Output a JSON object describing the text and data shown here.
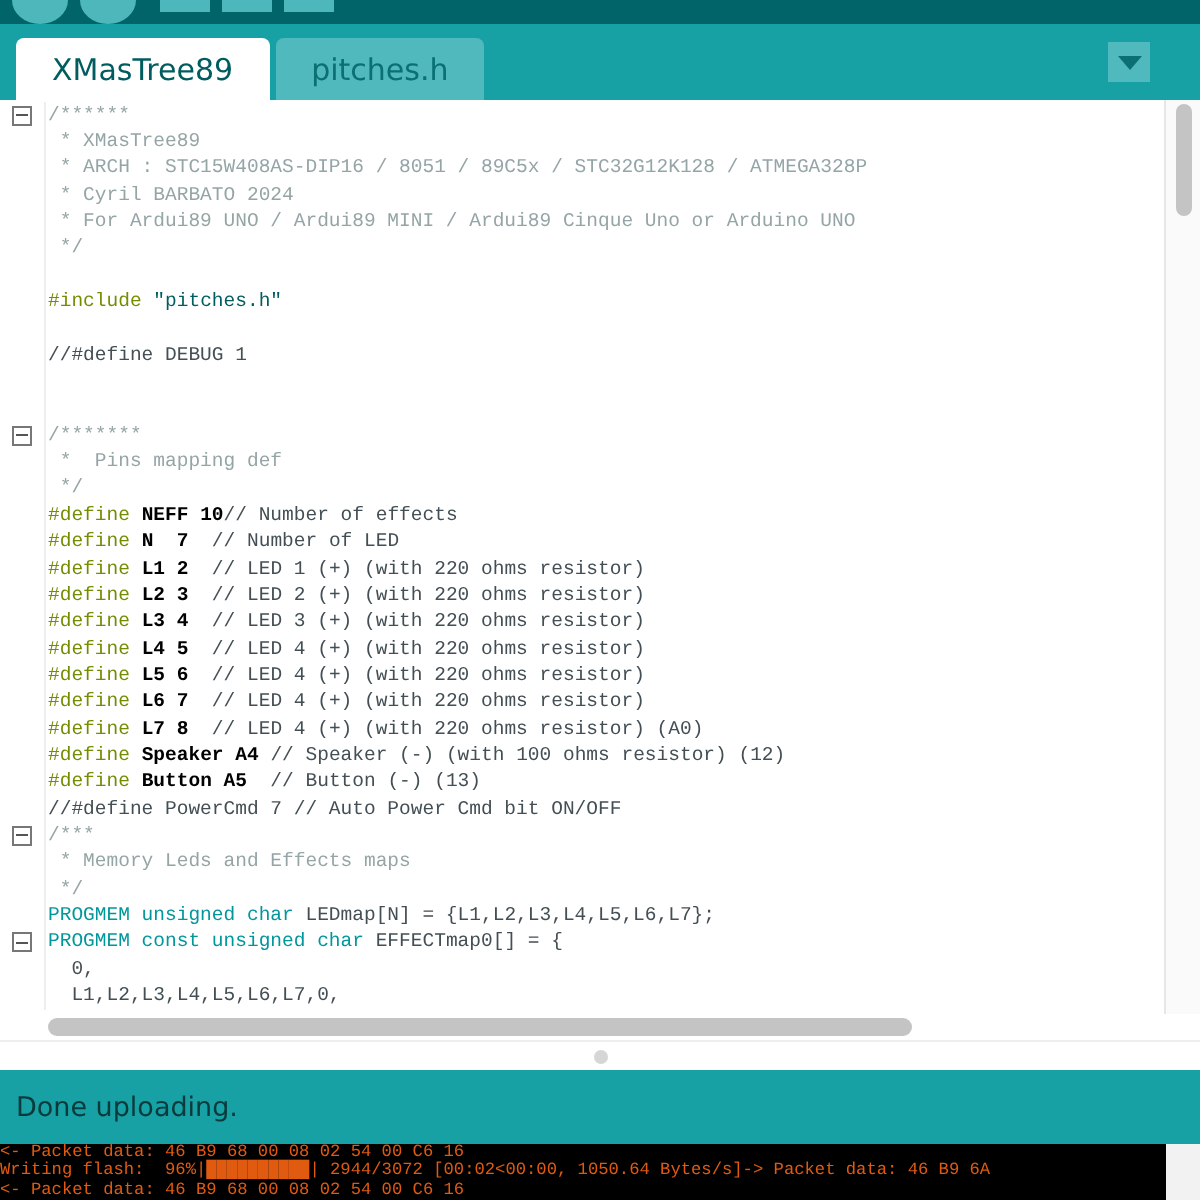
{
  "tabs": [
    {
      "label": "XMasTree89",
      "selected": true
    },
    {
      "label": "pitches.h",
      "selected": false
    }
  ],
  "editor": {
    "lines": [
      {
        "fold": true,
        "tokens": [
          {
            "kind": "comment",
            "text": "/******"
          }
        ]
      },
      {
        "fold": false,
        "tokens": [
          {
            "kind": "comment",
            "text": " * XMasTree89"
          }
        ]
      },
      {
        "fold": false,
        "tokens": [
          {
            "kind": "comment",
            "text": " * ARCH : STC15W408AS-DIP16 / 8051 / 89C5x / STC32G12K128 / ATMEGA328P"
          }
        ]
      },
      {
        "fold": false,
        "tokens": [
          {
            "kind": "comment",
            "text": " * Cyril BARBATO 2024"
          }
        ]
      },
      {
        "fold": false,
        "tokens": [
          {
            "kind": "comment",
            "text": " * For Ardui89 UNO / Ardui89 MINI / Ardui89 Cinque Uno or Arduino UNO"
          }
        ]
      },
      {
        "fold": false,
        "tokens": [
          {
            "kind": "comment",
            "text": " */"
          }
        ]
      },
      {
        "fold": false
      },
      {
        "fold": false,
        "tokens": [
          {
            "kind": "directive",
            "text": "#include"
          },
          {
            "kind": "string",
            "text": " \"pitches.h\""
          }
        ]
      },
      {
        "fold": false
      },
      {
        "fold": false,
        "tokens": [
          {
            "kind": "plain",
            "text": "//#define DEBUG 1"
          }
        ]
      },
      {
        "fold": false
      },
      {
        "fold": false
      },
      {
        "fold": true,
        "tokens": [
          {
            "kind": "comment",
            "text": "/*******"
          }
        ]
      },
      {
        "fold": false,
        "tokens": [
          {
            "kind": "comment",
            "text": " *  Pins mapping def"
          }
        ]
      },
      {
        "fold": false,
        "tokens": [
          {
            "kind": "comment",
            "text": " */"
          }
        ]
      },
      {
        "fold": false,
        "tokens": [
          {
            "kind": "directive",
            "text": "#define"
          },
          {
            "kind": "name",
            "text": " NEFF 10"
          },
          {
            "kind": "plain",
            "text": "// Number of effects"
          }
        ]
      },
      {
        "fold": false,
        "tokens": [
          {
            "kind": "directive",
            "text": "#define"
          },
          {
            "kind": "name",
            "text": " N  7"
          },
          {
            "kind": "plain",
            "text": "  // Number of LED"
          }
        ]
      },
      {
        "fold": false,
        "tokens": [
          {
            "kind": "directive",
            "text": "#define"
          },
          {
            "kind": "name",
            "text": " L1 2"
          },
          {
            "kind": "plain",
            "text": "  // LED 1 (+) (with 220 ohms resistor)"
          }
        ]
      },
      {
        "fold": false,
        "tokens": [
          {
            "kind": "directive",
            "text": "#define"
          },
          {
            "kind": "name",
            "text": " L2 3"
          },
          {
            "kind": "plain",
            "text": "  // LED 2 (+) (with 220 ohms resistor)"
          }
        ]
      },
      {
        "fold": false,
        "tokens": [
          {
            "kind": "directive",
            "text": "#define"
          },
          {
            "kind": "name",
            "text": " L3 4"
          },
          {
            "kind": "plain",
            "text": "  // LED 3 (+) (with 220 ohms resistor)"
          }
        ]
      },
      {
        "fold": false,
        "tokens": [
          {
            "kind": "directive",
            "text": "#define"
          },
          {
            "kind": "name",
            "text": " L4 5"
          },
          {
            "kind": "plain",
            "text": "  // LED 4 (+) (with 220 ohms resistor)"
          }
        ]
      },
      {
        "fold": false,
        "tokens": [
          {
            "kind": "directive",
            "text": "#define"
          },
          {
            "kind": "name",
            "text": " L5 6"
          },
          {
            "kind": "plain",
            "text": "  // LED 4 (+) (with 220 ohms resistor)"
          }
        ]
      },
      {
        "fold": false,
        "tokens": [
          {
            "kind": "directive",
            "text": "#define"
          },
          {
            "kind": "name",
            "text": " L6 7"
          },
          {
            "kind": "plain",
            "text": "  // LED 4 (+) (with 220 ohms resistor)"
          }
        ]
      },
      {
        "fold": false,
        "tokens": [
          {
            "kind": "directive",
            "text": "#define"
          },
          {
            "kind": "name",
            "text": " L7 8"
          },
          {
            "kind": "plain",
            "text": "  // LED 4 (+) (with 220 ohms resistor) (A0)"
          }
        ]
      },
      {
        "fold": false,
        "tokens": [
          {
            "kind": "directive",
            "text": "#define"
          },
          {
            "kind": "name",
            "text": " Speaker A4"
          },
          {
            "kind": "plain",
            "text": " // Speaker (-) (with 100 ohms resistor) (12)"
          }
        ]
      },
      {
        "fold": false,
        "tokens": [
          {
            "kind": "directive",
            "text": "#define"
          },
          {
            "kind": "name",
            "text": " Button A5"
          },
          {
            "kind": "plain",
            "text": "  // Button (-) (13)"
          }
        ]
      },
      {
        "fold": false,
        "tokens": [
          {
            "kind": "plain",
            "text": "//#define PowerCmd 7 // Auto Power Cmd bit ON/OFF"
          }
        ]
      },
      {
        "fold": true,
        "tokens": [
          {
            "kind": "comment",
            "text": "/***"
          }
        ]
      },
      {
        "fold": false,
        "tokens": [
          {
            "kind": "comment",
            "text": " * Memory Leds and Effects maps"
          }
        ]
      },
      {
        "fold": false,
        "tokens": [
          {
            "kind": "comment",
            "text": " */"
          }
        ]
      },
      {
        "fold": false,
        "tokens": [
          {
            "kind": "type",
            "text": "PROGMEM unsigned char"
          },
          {
            "kind": "plain",
            "text": " LEDmap[N] = {L1,L2,L3,L4,L5,L6,L7};"
          }
        ]
      },
      {
        "fold": true,
        "tokens": [
          {
            "kind": "type",
            "text": "PROGMEM const unsigned char"
          },
          {
            "kind": "plain",
            "text": " EFFECTmap0[] = {"
          }
        ]
      },
      {
        "fold": false,
        "tokens": [
          {
            "kind": "plain",
            "text": "  0,"
          }
        ]
      },
      {
        "fold": false,
        "tokens": [
          {
            "kind": "plain",
            "text": "  L1,L2,L3,L4,L5,L6,L7,0,"
          }
        ]
      }
    ]
  },
  "status": "Done uploading.",
  "console": [
    "<- Packet data: 46 B9 68 00 08 02 54 00 C6 16",
    "Writing flash:  96%|██████████| 2944/3072 [00:02<00:00, 1050.64 Bytes/s]-> Packet data: 46 B9 6A",
    "<- Packet data: 46 B9 68 00 08 02 54 00 C6 16"
  ]
}
